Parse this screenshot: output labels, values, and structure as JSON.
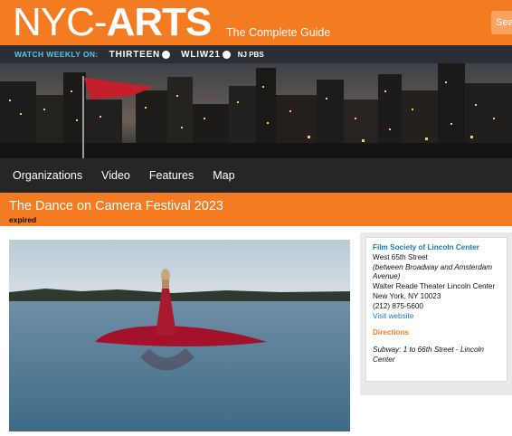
{
  "header": {
    "logo_left": "NYC-",
    "logo_right": "ARTS",
    "tagline": "The Complete Guide",
    "search_label": "Search",
    "brand_color": "#f37b21"
  },
  "watch_bar": {
    "label": "WATCH WEEKLY ON:",
    "stations": [
      "THIRTEEN",
      "WLIW21",
      "NJ PBS"
    ]
  },
  "nav": {
    "items": [
      "Organizations",
      "Video",
      "Features",
      "Map"
    ]
  },
  "event": {
    "title": "The Dance on Camera Festival 2023",
    "status": "expired"
  },
  "venue": {
    "name": "Film Society of Lincoln Center",
    "street": "West 65th Street",
    "cross_streets": "(between Broadway and Amsterdam Avenue)",
    "building": "Walter Reade Theater Lincoln Center",
    "city": "New York, NY 10023",
    "phone": "(212) 875-5600",
    "website_label": "Visit website",
    "directions_heading": "Directions",
    "directions_text": "Subway: 1 to 66th Street - Lincoln Center"
  }
}
